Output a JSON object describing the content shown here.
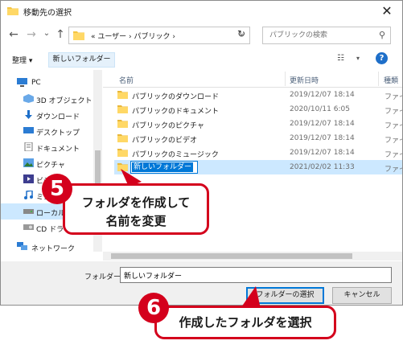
{
  "window": {
    "title": "移動先の選択",
    "close_glyph": "✕"
  },
  "nav": {
    "back_glyph": "←",
    "forward_glyph": "→",
    "history_glyph": "⌄",
    "up_glyph": "↑",
    "breadcrumb": "« ユーザー › パブリック ›",
    "address_dropdown_glyph": "⌄",
    "refresh_glyph": "↻",
    "search_placeholder": "パブリックの検索",
    "search_glyph": "⚲"
  },
  "toolbar": {
    "organize_label": "整理 ▾",
    "new_folder_label": "新しいフォルダー",
    "view_glyph": "☷",
    "view_dropdown_glyph": "▾",
    "help_glyph": "?"
  },
  "sidebar": {
    "items": [
      {
        "label": "PC",
        "icon": "pc-icon"
      },
      {
        "label": "3D オブジェクト",
        "icon": "3d-objects-icon"
      },
      {
        "label": "ダウンロード",
        "icon": "download-icon"
      },
      {
        "label": "デスクトップ",
        "icon": "desktop-icon"
      },
      {
        "label": "ドキュメント",
        "icon": "document-icon"
      },
      {
        "label": "ピクチャ",
        "icon": "pictures-icon"
      },
      {
        "label": "ビデオ",
        "icon": "videos-icon"
      },
      {
        "label": "ミュージック",
        "icon": "music-icon"
      },
      {
        "label": "ローカル ディスク (C:)",
        "icon": "drive-icon"
      },
      {
        "label": "CD ドライブ",
        "icon": "cd-drive-icon"
      },
      {
        "label": "ネットワーク",
        "icon": "network-icon"
      }
    ]
  },
  "columns": {
    "name": "名前",
    "date": "更新日時",
    "type": "種類"
  },
  "files": [
    {
      "name": "パブリックのダウンロード",
      "date": "2019/12/07 18:14",
      "type": "ファイ"
    },
    {
      "name": "パブリックのドキュメント",
      "date": "2020/10/11 6:05",
      "type": "ファイ"
    },
    {
      "name": "パブリックのピクチャ",
      "date": "2019/12/07 18:14",
      "type": "ファイ"
    },
    {
      "name": "パブリックのビデオ",
      "date": "2019/12/07 18:14",
      "type": "ファイ"
    },
    {
      "name": "パブリックのミュージック",
      "date": "2019/12/07 18:14",
      "type": "ファイ"
    },
    {
      "name": "新しいフォルダー",
      "date": "2021/02/02 11:33",
      "type": "ファイ"
    }
  ],
  "bottom": {
    "folder_label": "フォルダー:",
    "folder_value": "新しいフォルダー",
    "select_button": "フォルダーの選択",
    "cancel_button": "キャンセル"
  },
  "annotations": {
    "step5_number": "5",
    "step5_line1": "フォルダを作成して",
    "step5_line2": "名前を変更",
    "step6_number": "6",
    "step6_text": "作成したフォルダを選択"
  },
  "colors": {
    "accent": "#0078d7",
    "callout": "#d4001c",
    "folder": "#f4c542",
    "selection": "#cce8ff"
  }
}
